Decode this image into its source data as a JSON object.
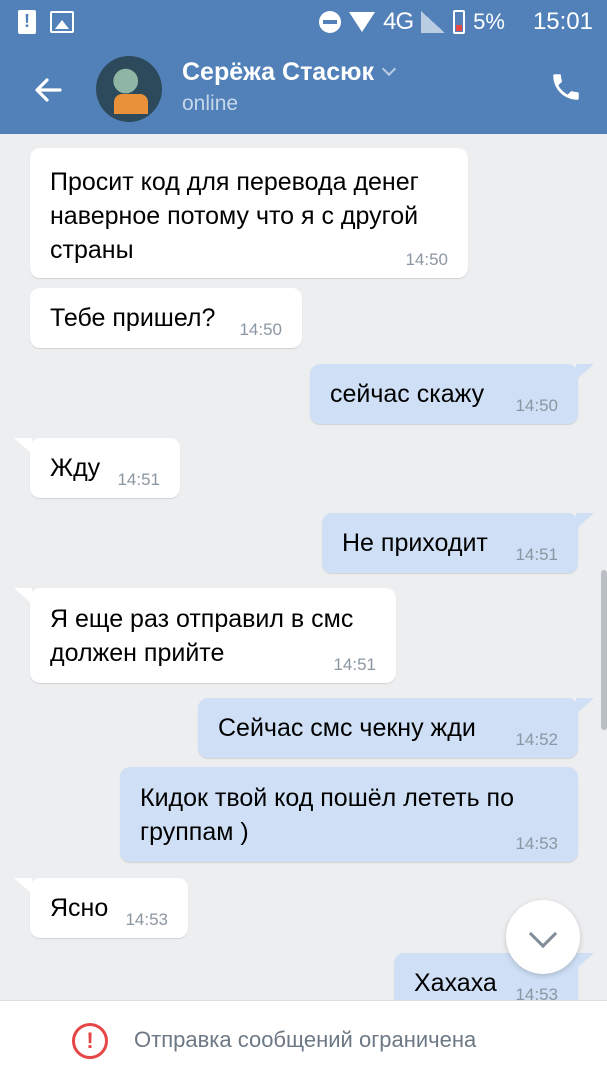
{
  "status_bar": {
    "network": "4G",
    "battery": "5%",
    "time": "15:01",
    "icons": [
      "sim-alert-icon",
      "image-icon",
      "dnd-icon",
      "wifi-icon",
      "signal-icon",
      "battery-icon"
    ]
  },
  "header": {
    "contact_name": "Серёжа Стасюк",
    "status": "online",
    "icons": [
      "back-arrow-icon",
      "chevron-down-icon",
      "phone-icon"
    ]
  },
  "messages": [
    {
      "side": "in",
      "text": "Просит код для перевода денег\nнаверное потому что я с другой\nстраны",
      "time": "14:50"
    },
    {
      "side": "in",
      "text": "Тебе пришел?",
      "time": "14:50"
    },
    {
      "side": "out",
      "text": "сейчас скажу",
      "time": "14:50"
    },
    {
      "side": "in",
      "text": "Жду",
      "time": "14:51"
    },
    {
      "side": "out",
      "text": "Не приходит",
      "time": "14:51"
    },
    {
      "side": "in",
      "text": "Я еще раз отправил в смс\nдолжен прийте",
      "time": "14:51"
    },
    {
      "side": "out",
      "text": "Сейчас смс чекну жди",
      "time": "14:52"
    },
    {
      "side": "out",
      "text": "Кидок  твой код пошёл лететь по\nгруппам )",
      "time": "14:53"
    },
    {
      "side": "in",
      "text": "Ясно",
      "time": "14:53"
    },
    {
      "side": "out",
      "text": "Хахаха",
      "time": "14:53"
    }
  ],
  "footer": {
    "notice": "Отправка сообщений ограничена",
    "icon": "warning-icon"
  },
  "colors": {
    "header_bg": "#5181b8",
    "chat_bg": "#edeef0",
    "incoming_bg": "#ffffff",
    "outgoing_bg": "#cfe0f6",
    "warning": "#e64646"
  }
}
